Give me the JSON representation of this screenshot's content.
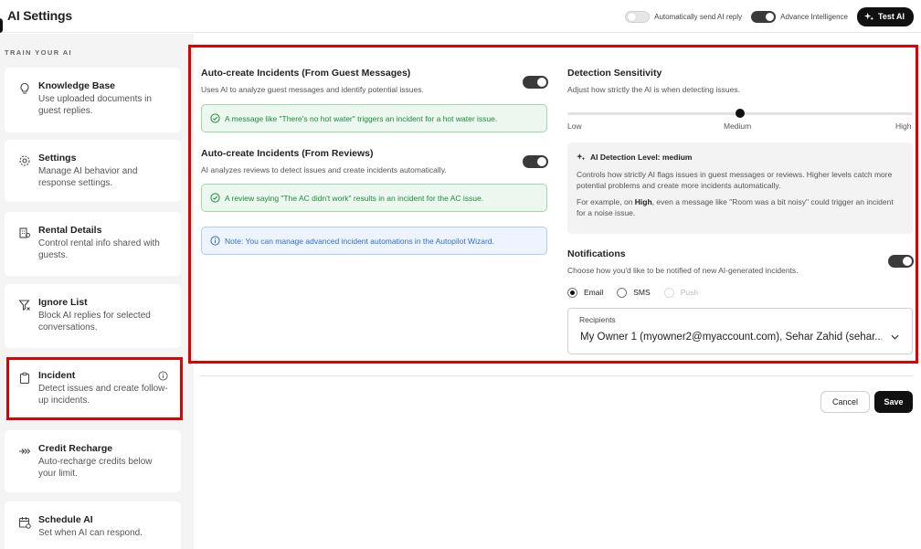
{
  "header": {
    "title": "AI Settings",
    "auto_send_label": "Automatically send AI reply",
    "auto_send_on": false,
    "advance_label": "Advance Intelligence",
    "advance_on": true,
    "test_button": "Test AI"
  },
  "sidebar": {
    "section_label": "TRAIN YOUR AI",
    "items": [
      {
        "title": "Knowledge Base",
        "desc": "Use uploaded documents in guest replies.",
        "icon": "lightbulb-icon"
      },
      {
        "title": "Settings",
        "desc": "Manage AI behavior and response settings.",
        "icon": "gear-icon"
      },
      {
        "title": "Rental Details",
        "desc": "Control rental info shared with guests.",
        "icon": "building-icon"
      },
      {
        "title": "Ignore List",
        "desc": "Block AI replies for selected conversations.",
        "icon": "filter-x-icon"
      },
      {
        "title": "Incident",
        "desc": "Detect issues and create follow-up incidents.",
        "icon": "clipboard-icon",
        "selected": true
      },
      {
        "title": "Credit Recharge",
        "desc": "Auto-recharge credits below your limit.",
        "icon": "recharge-icon"
      },
      {
        "title": "Schedule AI",
        "desc": "Set when AI can respond.",
        "icon": "calendar-icon"
      }
    ]
  },
  "incidents": {
    "guest": {
      "title": "Auto-create Incidents (From Guest Messages)",
      "desc": "Uses AI to analyze guest messages and identify potential issues.",
      "enabled": true,
      "example": "A message like \"There's no hot water\" triggers an incident for a hot water issue."
    },
    "reviews": {
      "title": "Auto-create Incidents (From Reviews)",
      "desc": "AI analyzes reviews to detect issues and create incidents automatically.",
      "enabled": true,
      "example": "A review saying \"The AC didn't work\" results in an incident for the AC issue."
    },
    "note": "Note: You can manage advanced incident automations in the Autopilot Wizard."
  },
  "detection": {
    "title": "Detection Sensitivity",
    "desc": "Adjust how strictly the AI is when detecting issues.",
    "labels": {
      "low": "Low",
      "medium": "Medium",
      "high": "High"
    },
    "level_fraction": 0.5,
    "box_title": "AI Detection Level: medium",
    "box_text": "Controls how strictly AI flags issues in guest messages or reviews. Higher levels catch more potential problems and create more incidents automatically.",
    "box_example_prefix": "For example, on ",
    "box_example_bold": "High",
    "box_example_suffix": ", even a message like \"Room was a bit noisy\" could trigger an incident for a noise issue."
  },
  "notifications": {
    "title": "Notifications",
    "desc": "Choose how you'd like to be notified of new AI-generated incidents.",
    "enabled": true,
    "options": {
      "email": "Email",
      "sms": "SMS",
      "push": "Push"
    },
    "selected": "email",
    "recipients_label": "Recipients",
    "recipients_value": "My Owner 1 (myowner2@myaccount.com), Sehar Zahid (sehar"
  },
  "actions": {
    "cancel": "Cancel",
    "save": "Save"
  }
}
